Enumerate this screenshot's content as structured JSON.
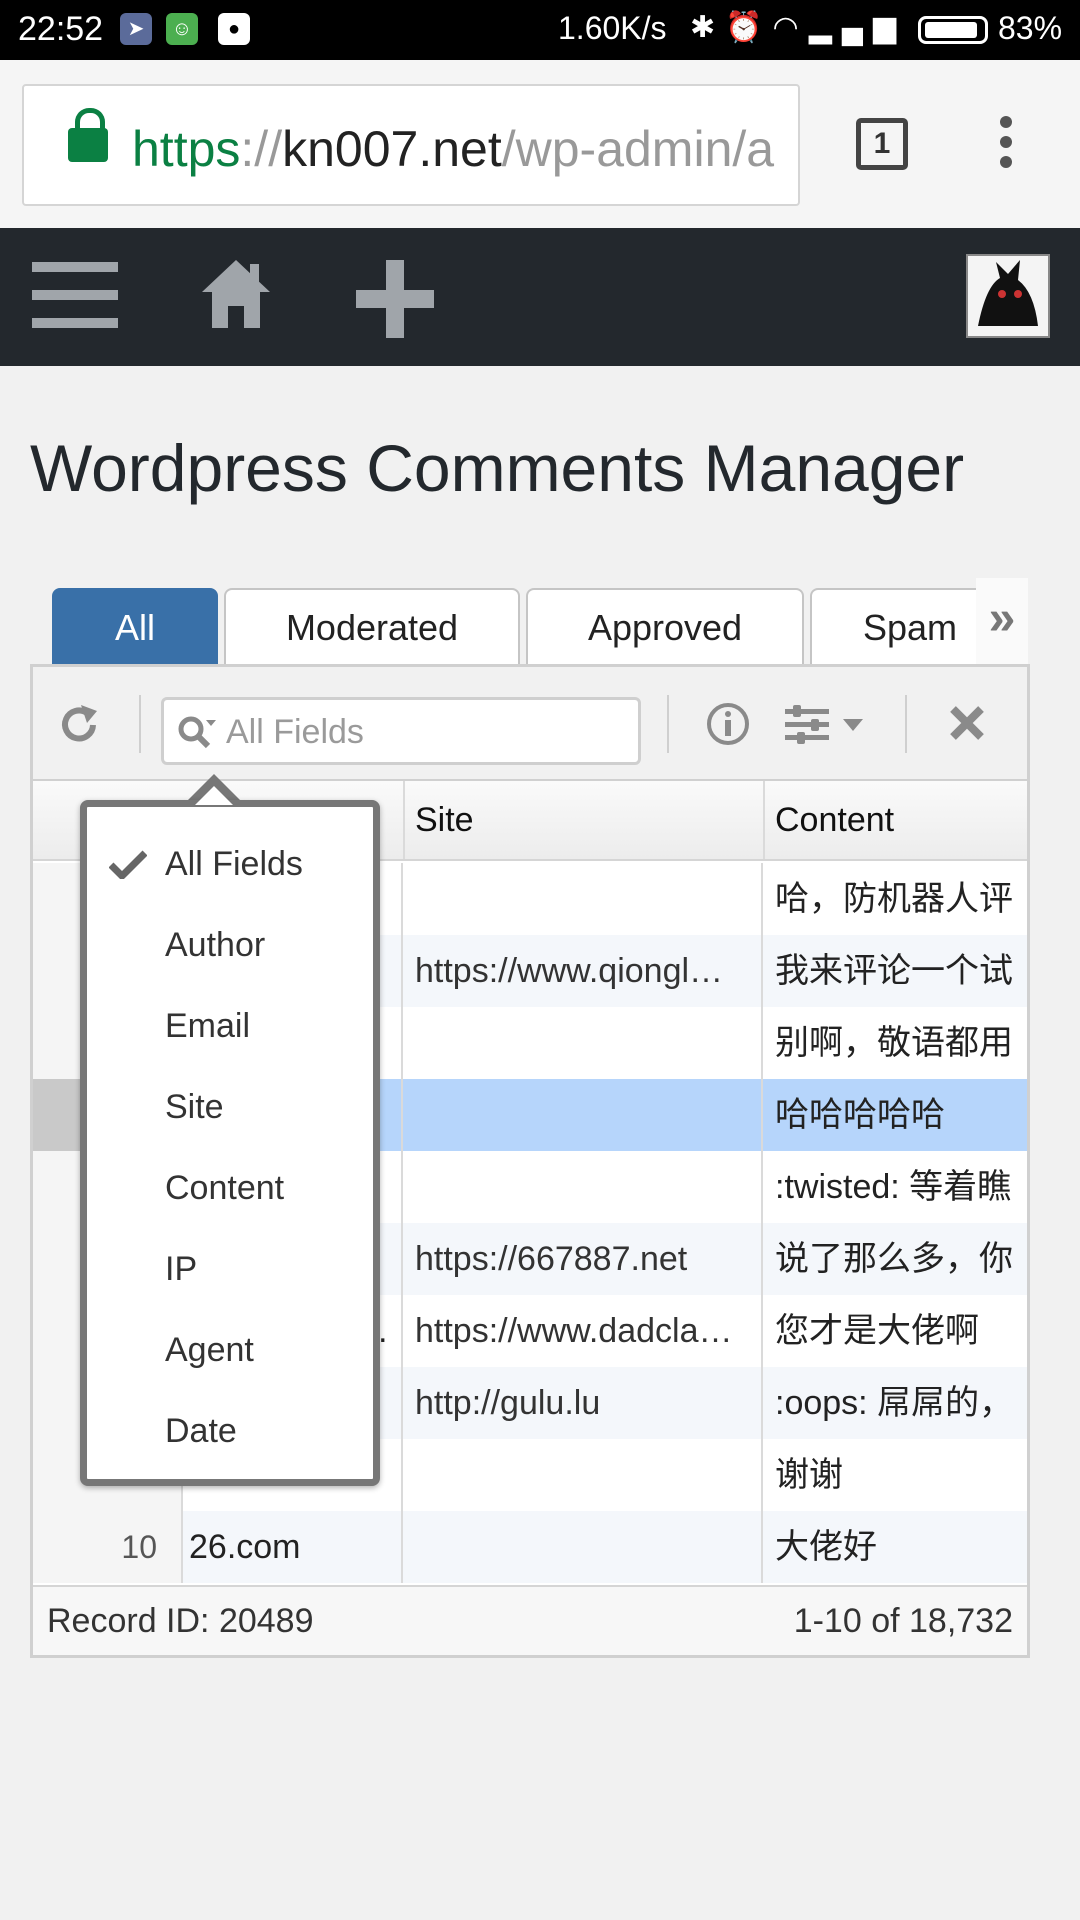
{
  "status_bar": {
    "time": "22:52",
    "net_speed": "1.60K/s",
    "network": "3G 1X",
    "battery": "83%",
    "battery_level": 0.83
  },
  "browser": {
    "url_scheme": "https",
    "url_sep": "://",
    "url_host": "kn007.net",
    "url_path": "/wp-admin/a",
    "tab_count": "1"
  },
  "page": {
    "title": "Wordpress Comments Manager"
  },
  "tabs": [
    {
      "label": "All",
      "active": true
    },
    {
      "label": "Moderated",
      "active": false
    },
    {
      "label": "Approved",
      "active": false
    },
    {
      "label": "Spam",
      "active": false
    }
  ],
  "toolbar": {
    "search_placeholder": "All Fields"
  },
  "columns": {
    "site": "Site",
    "content": "Content"
  },
  "rows": [
    {
      "num": "",
      "author": "",
      "site": "",
      "content": "哈，防机器人评"
    },
    {
      "num": "",
      "author": "",
      "site": "https://www.qiongl…",
      "content": "我来评论一个试"
    },
    {
      "num": "",
      "author": "",
      "site": "",
      "content": "别啊，敬语都用"
    },
    {
      "num": "",
      "author": "",
      "site": "",
      "content": "哈哈哈哈哈"
    },
    {
      "num": "",
      "author": "",
      "site": "",
      "content": ":twisted: 等着瞧"
    },
    {
      "num": "",
      "author": "",
      "site": "https://667887.net",
      "content": "说了那么多，你"
    },
    {
      "num": "",
      "author": "…",
      "site": "https://www.dadcla…",
      "content": "您才是大佬啊"
    },
    {
      "num": "",
      "author": "",
      "site": "http://gulu.lu",
      "content": ":oops: 屌屌的，"
    },
    {
      "num": "",
      "author": "",
      "site": "",
      "content": "谢谢"
    },
    {
      "num": "10",
      "author": "26.com",
      "site": "",
      "content": "大佬好"
    }
  ],
  "footer": {
    "record": "Record ID: 20489",
    "range": "1-10 of 18,732"
  },
  "search_menu": {
    "items": [
      "All Fields",
      "Author",
      "Email",
      "Site",
      "Content",
      "IP",
      "Agent",
      "Date"
    ],
    "checked": "All Fields"
  },
  "colors": {
    "admin_bar": "#23282d",
    "active_tab": "#3970a8",
    "selected_row": "#b6d5fb",
    "secure_green": "#0b8043"
  }
}
